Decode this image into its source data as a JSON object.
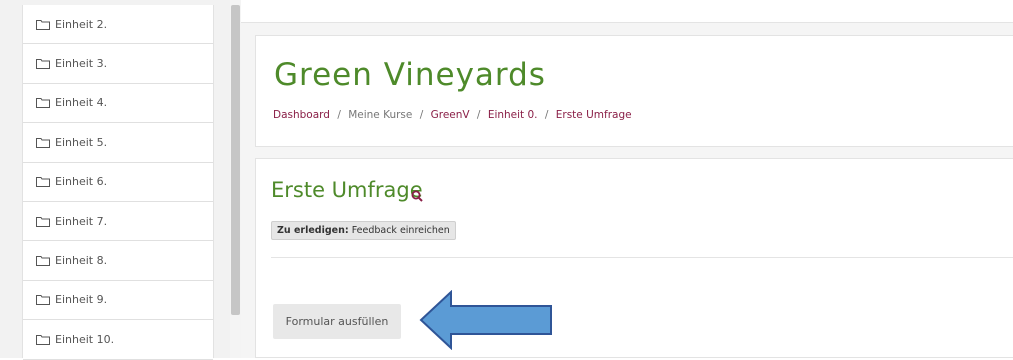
{
  "sidebar": {
    "items": [
      {
        "label": "Einheit 2."
      },
      {
        "label": "Einheit 3."
      },
      {
        "label": "Einheit 4."
      },
      {
        "label": "Einheit 5."
      },
      {
        "label": "Einheit 6."
      },
      {
        "label": "Einheit 7."
      },
      {
        "label": "Einheit 8."
      },
      {
        "label": "Einheit 9."
      },
      {
        "label": "Einheit 10."
      }
    ]
  },
  "header": {
    "course_title": "Green Vineyards",
    "breadcrumb": {
      "separator": "/",
      "items": [
        "Dashboard",
        "Meine Kurse",
        "GreenV",
        "Einheit 0.",
        "Erste Umfrage"
      ]
    }
  },
  "activity": {
    "title": "Erste Umfrage",
    "todo_label": "Zu erledigen:",
    "todo_text": "Feedback einreichen",
    "button_label": "Formular ausfüllen"
  },
  "colors": {
    "title_green": "#4e8a2a",
    "link_maroon": "#8a1f47",
    "arrow_fill": "#5b9bd5",
    "arrow_stroke": "#2f5597"
  },
  "icons": {
    "sidebar_item": "folder-icon",
    "title_suffix": "search-icon",
    "annotation": "arrow-left-annotation"
  }
}
